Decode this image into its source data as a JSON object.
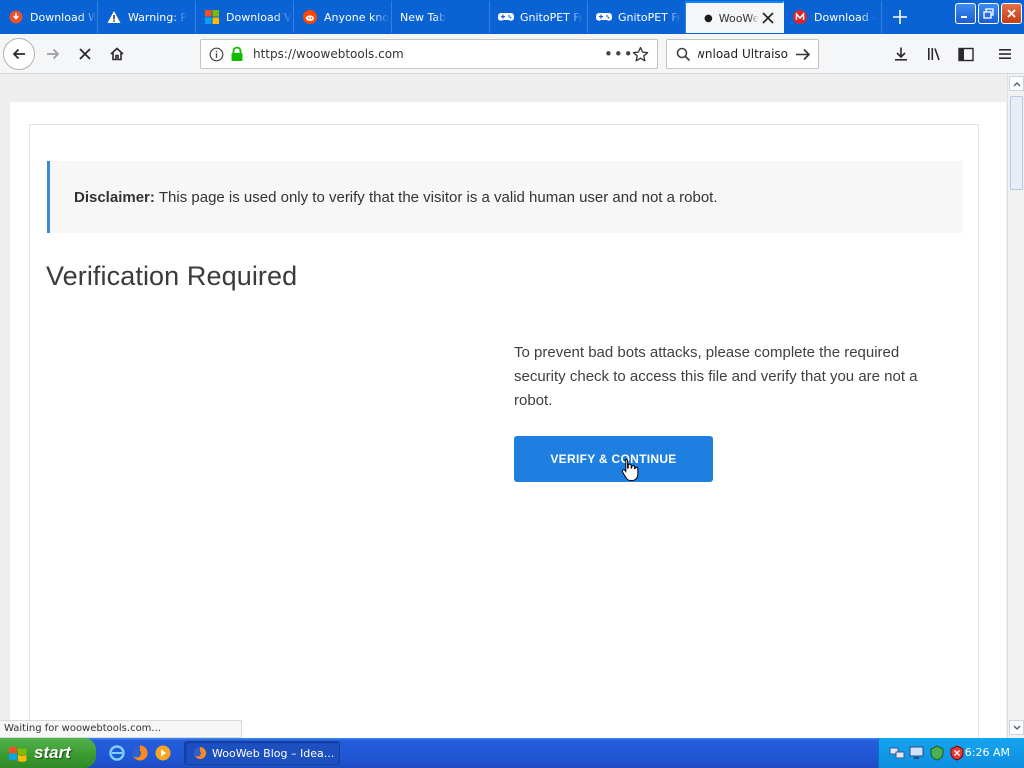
{
  "browser": {
    "tabs": [
      {
        "label": "Download W",
        "icon": "download-circle-icon",
        "active": false
      },
      {
        "label": "Warning: P",
        "icon": "warning-icon",
        "active": false
      },
      {
        "label": "Download V",
        "icon": "windows-logo-icon",
        "active": false
      },
      {
        "label": "Anyone kno",
        "icon": "reddit-icon",
        "active": false
      },
      {
        "label": "New Tab",
        "icon": "",
        "active": false
      },
      {
        "label": "GnitoPET Fr",
        "icon": "gamepad-icon",
        "active": false
      },
      {
        "label": "GnitoPET Fr",
        "icon": "gamepad-icon",
        "active": false
      },
      {
        "label": "WooWe",
        "icon": "loading-dot-icon",
        "active": true
      },
      {
        "label": "Download -",
        "icon": "mega-icon",
        "active": false
      }
    ],
    "url": "https://woowebtools.com",
    "search_text": "ownload Ultraiso",
    "status_text": "Waiting for woowebtools.com..."
  },
  "page": {
    "disclaimer_label": "Disclaimer:",
    "disclaimer_text": "This page is used only to verify that the visitor is a valid human user and not a robot.",
    "title": "Verification Required",
    "prevent_text": "To prevent bad bots attacks, please complete the required security check to access this file and verify that you are not a robot.",
    "verify_button": "VERIFY & CONTINUE"
  },
  "taskbar": {
    "start_label": "start",
    "task_item": "WooWeb Blog – Idea...",
    "clock": "6:26 AM"
  },
  "colors": {
    "titlebar": "#0a63d4",
    "accent": "#1e7fe0",
    "disclaimer_border": "#3a8bd6",
    "start_green": "#3c9b33"
  }
}
